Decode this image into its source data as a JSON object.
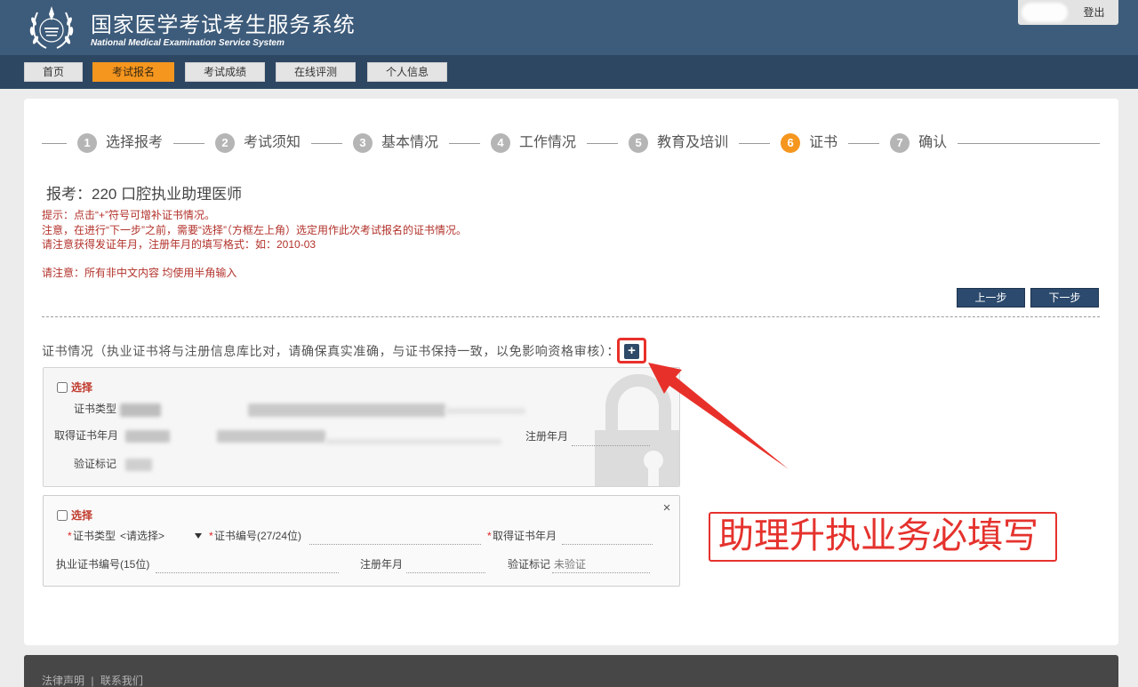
{
  "header": {
    "title": "国家医学考试考生服务系统",
    "subtitle": "National Medical Examination Service System",
    "logout_label": "登出"
  },
  "nav": {
    "items": [
      {
        "label": "首页"
      },
      {
        "label": "考试报名",
        "active": true
      },
      {
        "label": "考试成绩"
      },
      {
        "label": "在线评测"
      },
      {
        "label": "个人信息"
      }
    ]
  },
  "steps": [
    {
      "num": "1",
      "label": "选择报考"
    },
    {
      "num": "2",
      "label": "考试须知"
    },
    {
      "num": "3",
      "label": "基本情况"
    },
    {
      "num": "4",
      "label": "工作情况"
    },
    {
      "num": "5",
      "label": "教育及培训"
    },
    {
      "num": "6",
      "label": "证书",
      "active": true
    },
    {
      "num": "7",
      "label": "确认"
    }
  ],
  "exam_title": "报考：220 口腔执业助理医师",
  "notices": [
    "提示：点击“+”符号可增补证书情况。",
    "注意，在进行“下一步”之前，需要“选择”（方框左上角）选定用作此次考试报名的证书情况。",
    "请注意获得发证年月，注册年月的填写格式：如：2010-03",
    "请注意：所有非中文内容 均使用半角输入"
  ],
  "actions": {
    "prev_label": "上一步",
    "next_label": "下一步"
  },
  "certificates": {
    "section_label": "证书情况（执业证书将与注册信息库比对，请确保真实准确，与证书保持一致，以免影响资格审核）：",
    "add_symbol": "+",
    "existing": {
      "select_label": "选择",
      "type_label": "证书类型",
      "obtained_label": "取得证书年月",
      "registered_label": "注册年月",
      "verify_label": "验证标记"
    },
    "new_entry": {
      "select_label": "选择",
      "close_symbol": "×",
      "required_mark": "*",
      "type_label": "证书类型",
      "type_value": "<请选择>",
      "number_label": "证书编号(27/24位)",
      "obtained_label": "取得证书年月",
      "practice_number_label": "执业证书编号(15位)",
      "registered_label": "注册年月",
      "verify_label": "验证标记",
      "verify_value": "未验证"
    }
  },
  "annotation": {
    "text": "助理升执业务必填写"
  },
  "footer": {
    "links": [
      "法律声明",
      "联系我们"
    ],
    "separator": "|"
  },
  "icons": {
    "logo": "medical-emblem-icon",
    "add": "plus-icon",
    "close": "close-icon",
    "dropdown": "chevron-down-icon",
    "watermark": "lock-icon",
    "annotation": "arrow-icon"
  },
  "colors": {
    "header": "#3d5b7a",
    "nav_bar": "#2d4763",
    "accent": "#f5961f",
    "notice_red": "#b2322b",
    "button_navy": "#2b4a6d",
    "annotation_red": "#e5322d"
  }
}
